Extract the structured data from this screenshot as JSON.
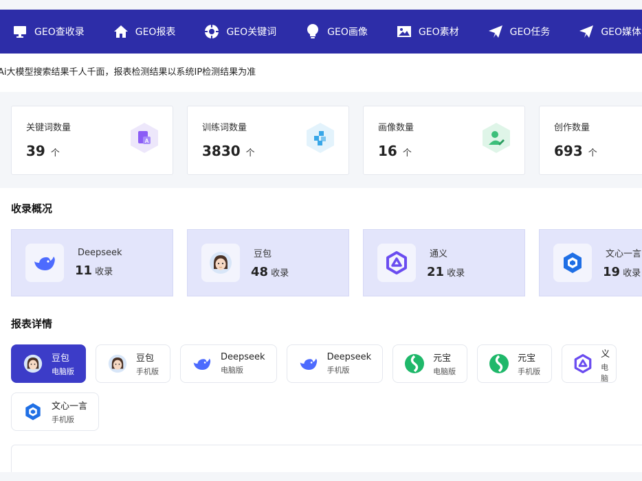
{
  "nav": {
    "items": [
      {
        "label": "GEO查收录",
        "icon": "monitor-icon"
      },
      {
        "label": "GEO报表",
        "icon": "home-icon"
      },
      {
        "label": "GEO关键词",
        "icon": "target-icon"
      },
      {
        "label": "GEO画像",
        "icon": "lightbulb-icon"
      },
      {
        "label": "GEO素材",
        "icon": "image-icon"
      },
      {
        "label": "GEO任务",
        "icon": "paper-plane-icon"
      },
      {
        "label": "GEO媒体源",
        "icon": "paper-plane-icon"
      }
    ]
  },
  "notice": "Ai大模型搜索结果千人千面，报表检测结果以系统IP检测结果为准",
  "stats": [
    {
      "label": "关键词数量",
      "value": "39",
      "unit": "个",
      "icon": "document-translate-icon",
      "color": "#8b5cf6"
    },
    {
      "label": "训练词数量",
      "value": "3830",
      "unit": "个",
      "icon": "puzzle-icon",
      "color": "#38a7e8"
    },
    {
      "label": "画像数量",
      "value": "16",
      "unit": "个",
      "icon": "user-edit-icon",
      "color": "#3cbf7a"
    },
    {
      "label": "创作数量",
      "value": "693",
      "unit": "个",
      "icon": "create-icon",
      "color": "#f0a030"
    }
  ],
  "coverage": {
    "title": "收录概况",
    "items": [
      {
        "name": "Deepseek",
        "count": "11",
        "unit": "收录",
        "icon": "deepseek-icon"
      },
      {
        "name": "豆包",
        "count": "48",
        "unit": "收录",
        "icon": "doubao-icon"
      },
      {
        "name": "通义",
        "count": "21",
        "unit": "收录",
        "icon": "tongyi-icon"
      },
      {
        "name": "文心一言",
        "count": "19",
        "unit": "收录",
        "icon": "wenxin-icon"
      }
    ]
  },
  "reports": {
    "title": "报表详情",
    "items": [
      {
        "name": "豆包",
        "platform": "电脑版",
        "icon": "doubao-icon",
        "active": true
      },
      {
        "name": "豆包",
        "platform": "手机版",
        "icon": "doubao-icon",
        "active": false
      },
      {
        "name": "Deepseek",
        "platform": "电脑版",
        "icon": "deepseek-icon",
        "active": false
      },
      {
        "name": "Deepseek",
        "platform": "手机版",
        "icon": "deepseek-icon",
        "active": false
      },
      {
        "name": "元宝",
        "platform": "电脑版",
        "icon": "yuanbao-icon",
        "active": false
      },
      {
        "name": "元宝",
        "platform": "手机版",
        "icon": "yuanbao-icon",
        "active": false
      },
      {
        "name": "通义",
        "platform": "电脑版",
        "icon": "tongyi-icon",
        "active": false
      },
      {
        "name": "文心一言",
        "platform": "手机版",
        "icon": "wenxin-icon",
        "active": false
      }
    ]
  },
  "colors": {
    "nav_bg": "#2d2da8",
    "active": "#3c3cc8",
    "card_bg": "#e3e5fb"
  }
}
